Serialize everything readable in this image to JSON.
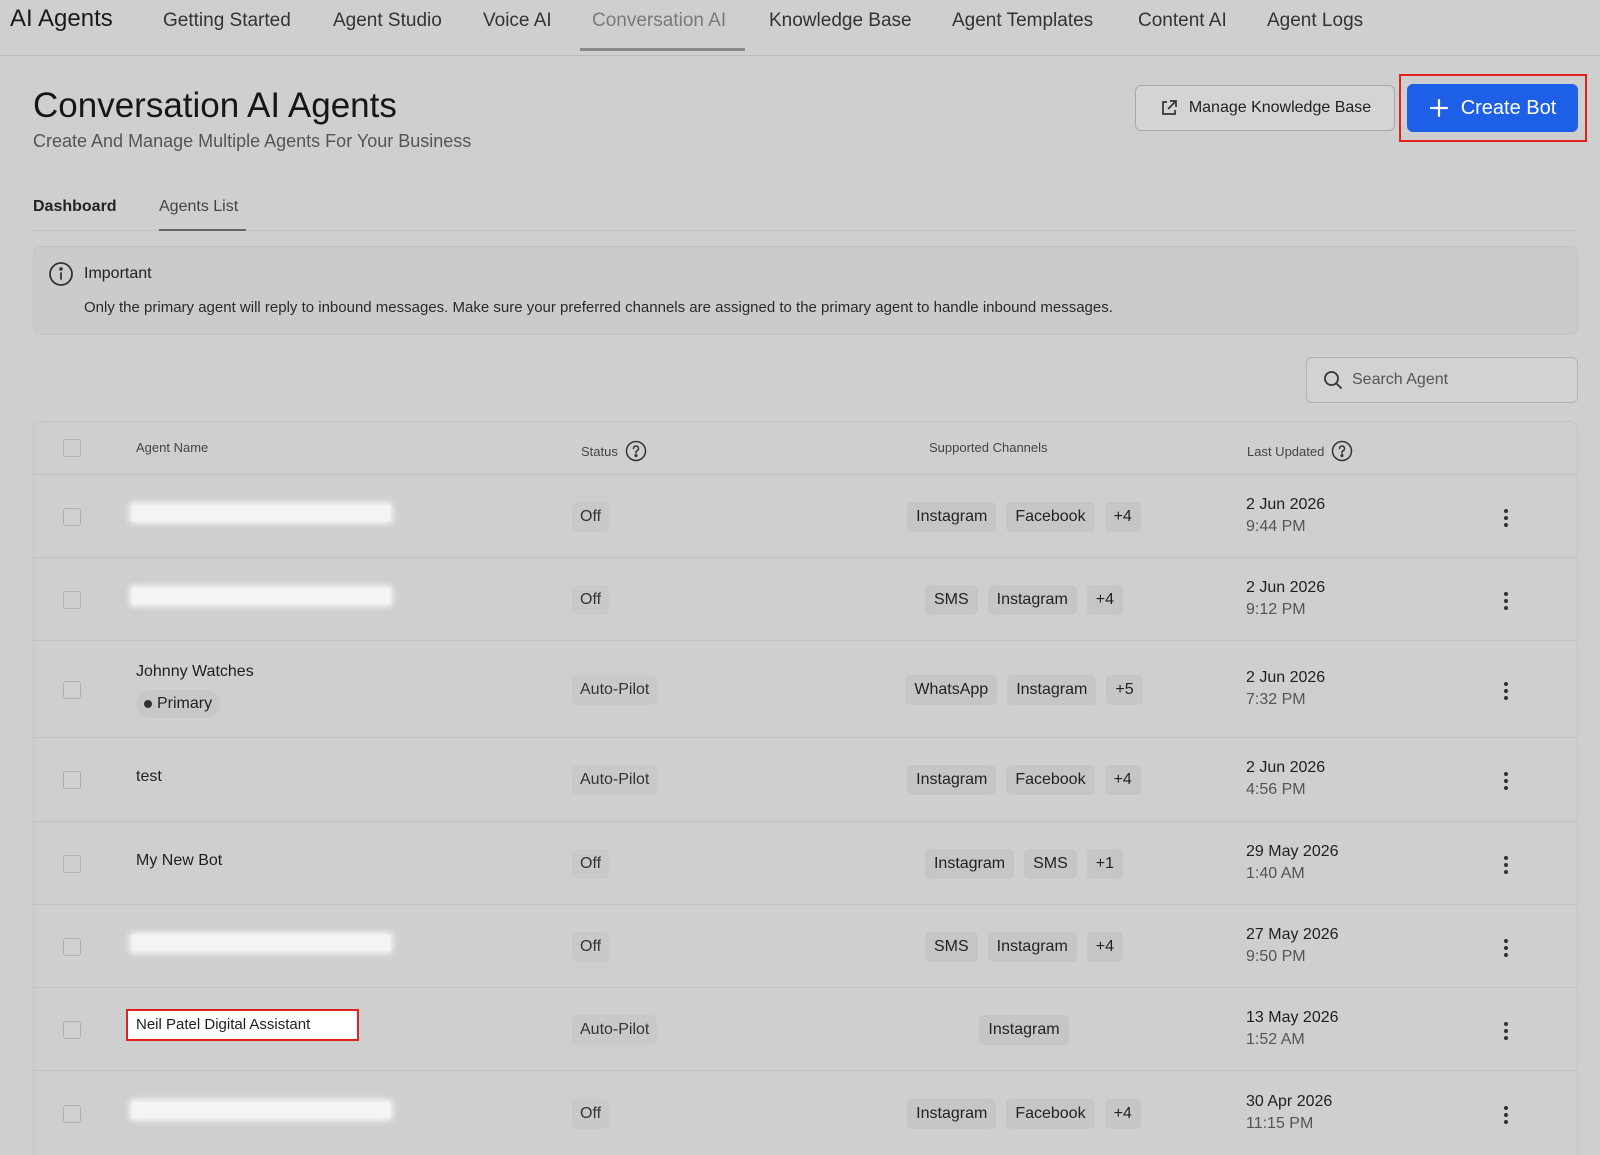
{
  "app": {
    "title": "AI Agents"
  },
  "nav": {
    "tabs": [
      "Getting Started",
      "Agent Studio",
      "Voice AI",
      "Conversation AI",
      "Knowledge Base",
      "Agent Templates",
      "Content AI",
      "Agent Logs"
    ],
    "active": "Conversation AI"
  },
  "header": {
    "title": "Conversation AI Agents",
    "subtitle": "Create And Manage Multiple Agents For Your Business",
    "manage_kb_label": "Manage Knowledge Base",
    "create_bot_label": "Create Bot"
  },
  "subtabs": [
    "Dashboard",
    "Agents List"
  ],
  "notice": {
    "title": "Important",
    "text": "Only the primary agent will reply to inbound messages. Make sure your preferred channels are assigned to the primary agent to handle inbound messages."
  },
  "search": {
    "placeholder": "Search Agent"
  },
  "table": {
    "columns": [
      "Agent Name",
      "Status",
      "Supported Channels",
      "Last Updated"
    ],
    "rows": [
      {
        "name": "",
        "redacted": true,
        "primary": "",
        "status": "Off",
        "channels": [
          "Instagram",
          "Facebook",
          "+4"
        ],
        "date": "2 Jun 2026",
        "time": "9:44 PM"
      },
      {
        "name": "",
        "redacted": true,
        "primary": "",
        "status": "Off",
        "channels": [
          "SMS",
          "Instagram",
          "+4"
        ],
        "date": "2 Jun 2026",
        "time": "9:12 PM"
      },
      {
        "name": "Johnny Watches",
        "redacted": false,
        "primary": "Primary",
        "status": "Auto-Pilot",
        "channels": [
          "WhatsApp",
          "Instagram",
          "+5"
        ],
        "date": "2 Jun 2026",
        "time": "7:32 PM"
      },
      {
        "name": "test",
        "redacted": false,
        "primary": "",
        "status": "Auto-Pilot",
        "channels": [
          "Instagram",
          "Facebook",
          "+4"
        ],
        "date": "2 Jun 2026",
        "time": "4:56 PM"
      },
      {
        "name": "My New Bot",
        "redacted": false,
        "primary": "",
        "status": "Off",
        "channels": [
          "Instagram",
          "SMS",
          "+1"
        ],
        "date": "29 May 2026",
        "time": "1:40 AM"
      },
      {
        "name": "",
        "redacted": true,
        "primary": "",
        "status": "Off",
        "channels": [
          "SMS",
          "Instagram",
          "+4"
        ],
        "date": "27 May 2026",
        "time": "9:50 PM"
      },
      {
        "name": "Neil Patel Digital Assistant",
        "redacted": false,
        "primary": "",
        "status": "Auto-Pilot",
        "channels": [
          "Instagram"
        ],
        "date": "13 May 2026",
        "time": "1:52 AM"
      },
      {
        "name": "",
        "redacted": true,
        "primary": "",
        "status": "Off",
        "channels": [
          "Instagram",
          "Facebook",
          "+4"
        ],
        "date": "30 Apr 2026",
        "time": "11:15 PM"
      }
    ]
  },
  "colors": {
    "accent": "#1d5fe6",
    "highlight": "#e0211c",
    "background": "#cfcfcf"
  }
}
